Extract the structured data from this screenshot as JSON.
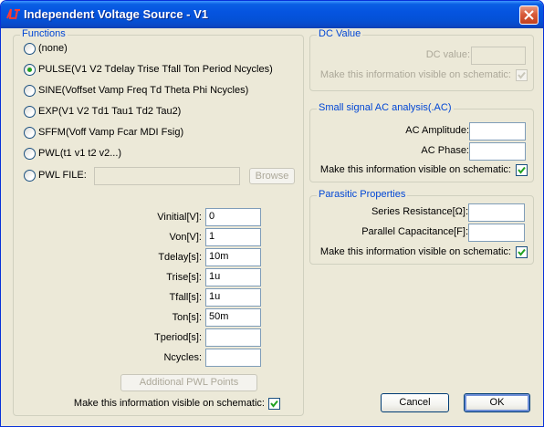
{
  "window": {
    "title": "Independent Voltage Source - V1"
  },
  "functions": {
    "legend": "Functions",
    "options": [
      {
        "label": "(none)",
        "selected": false
      },
      {
        "label": "PULSE(V1 V2 Tdelay Trise Tfall Ton Period Ncycles)",
        "selected": true
      },
      {
        "label": "SINE(Voffset Vamp Freq Td Theta Phi Ncycles)",
        "selected": false
      },
      {
        "label": "EXP(V1 V2 Td1 Tau1 Td2 Tau2)",
        "selected": false
      },
      {
        "label": "SFFM(Voff Vamp Fcar MDI Fsig)",
        "selected": false
      },
      {
        "label": "PWL(t1 v1 t2 v2...)",
        "selected": false
      },
      {
        "label": "PWL FILE:",
        "selected": false
      }
    ],
    "pwl_file_value": "",
    "browse_label": "Browse",
    "params": [
      {
        "label": "Vinitial[V]:",
        "value": "0"
      },
      {
        "label": "Von[V]:",
        "value": "1"
      },
      {
        "label": "Tdelay[s]:",
        "value": "10m"
      },
      {
        "label": "Trise[s]:",
        "value": "1u"
      },
      {
        "label": "Tfall[s]:",
        "value": "1u"
      },
      {
        "label": "Ton[s]:",
        "value": "50m"
      },
      {
        "label": "Tperiod[s]:",
        "value": ""
      },
      {
        "label": "Ncycles:",
        "value": ""
      }
    ],
    "additional_pwl_label": "Additional PWL Points",
    "visible_label": "Make this information visible on schematic:",
    "visible_checked": true
  },
  "dc_value": {
    "legend": "DC Value",
    "label": "DC value:",
    "value": "",
    "visible_label": "Make this information visible on schematic:",
    "visible_checked": true
  },
  "ac": {
    "legend": "Small signal AC analysis(.AC)",
    "amplitude_label": "AC Amplitude:",
    "amplitude_value": "",
    "phase_label": "AC Phase:",
    "phase_value": "",
    "visible_label": "Make this information visible on schematic:",
    "visible_checked": true
  },
  "parasitic": {
    "legend": "Parasitic Properties",
    "series_label": "Series Resistance[Ω]:",
    "series_value": "",
    "parallel_label": "Parallel Capacitance[F]:",
    "parallel_value": "",
    "visible_label": "Make this information visible on schematic:",
    "visible_checked": true
  },
  "buttons": {
    "cancel": "Cancel",
    "ok": "OK"
  },
  "colors": {
    "accent_check": "#21a121",
    "legend_blue": "#0046d5",
    "titlebar_blue": "#0554e0"
  }
}
